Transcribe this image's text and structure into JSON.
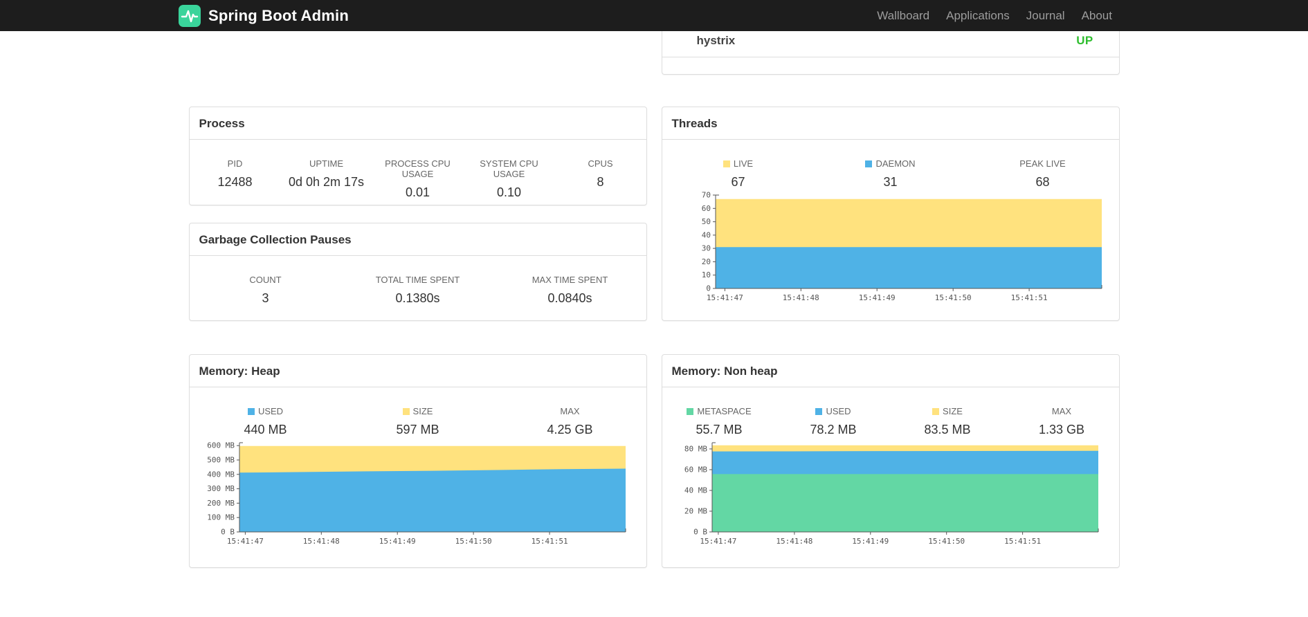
{
  "navbar": {
    "brand": "Spring Boot Admin",
    "items": [
      {
        "label": "Wallboard"
      },
      {
        "label": "Applications"
      },
      {
        "label": "Journal"
      },
      {
        "label": "About"
      }
    ]
  },
  "colors": {
    "brand_green": "#3AD49B",
    "status_up": "#2FBE2F",
    "chart_yellow": "#FFE27E",
    "chart_blue": "#4FB2E6",
    "chart_green": "#63D7A4"
  },
  "health": {
    "service": "hystrix",
    "status": "UP"
  },
  "process": {
    "title": "Process",
    "metrics": [
      {
        "label": "PID",
        "value": "12488"
      },
      {
        "label": "UPTIME",
        "value": "0d 0h 2m 17s"
      },
      {
        "label": "PROCESS CPU USAGE",
        "value": "0.01"
      },
      {
        "label": "SYSTEM CPU USAGE",
        "value": "0.10"
      },
      {
        "label": "CPUS",
        "value": "8"
      }
    ]
  },
  "gc": {
    "title": "Garbage Collection Pauses",
    "metrics": [
      {
        "label": "COUNT",
        "value": "3"
      },
      {
        "label": "TOTAL TIME SPENT",
        "value": "0.1380s"
      },
      {
        "label": "MAX TIME SPENT",
        "value": "0.0840s"
      }
    ]
  },
  "chart_data": [
    {
      "type": "area",
      "title": "Threads",
      "legend_position": "top",
      "grid": false,
      "ylim": [
        0,
        70
      ],
      "yticks": [
        {
          "value": 0,
          "label": "0"
        },
        {
          "value": 10,
          "label": "10"
        },
        {
          "value": 20,
          "label": "20"
        },
        {
          "value": 30,
          "label": "30"
        },
        {
          "value": 40,
          "label": "40"
        },
        {
          "value": 50,
          "label": "50"
        },
        {
          "value": 60,
          "label": "60"
        },
        {
          "value": 70,
          "label": "70"
        }
      ],
      "xticks": [
        {
          "pos": 0.024,
          "label": "15:41:47"
        },
        {
          "pos": 0.221,
          "label": "15:41:48"
        },
        {
          "pos": 0.418,
          "label": "15:41:49"
        },
        {
          "pos": 0.615,
          "label": "15:41:50"
        },
        {
          "pos": 0.812,
          "label": "15:41:51"
        }
      ],
      "legend": [
        {
          "label": "LIVE",
          "value": "67",
          "color": "#FFE27E"
        },
        {
          "label": "DAEMON",
          "value": "31",
          "color": "#4FB2E6"
        },
        {
          "label": "PEAK LIVE",
          "value": "68"
        }
      ],
      "layers": [
        {
          "name": "LIVE",
          "color": "#FFE27E",
          "values": [
            67,
            67,
            67,
            67,
            67,
            67,
            67
          ]
        },
        {
          "name": "DAEMON",
          "color": "#4FB2E6",
          "values": [
            31,
            31,
            31,
            31,
            31,
            31,
            31
          ]
        }
      ]
    },
    {
      "type": "area",
      "title": "Memory: Heap",
      "legend_position": "top",
      "grid": false,
      "ylim": [
        0,
        620
      ],
      "unit": "MB",
      "yticks": [
        {
          "value": 0,
          "label": "0 B"
        },
        {
          "value": 100,
          "label": "100 MB"
        },
        {
          "value": 200,
          "label": "200 MB"
        },
        {
          "value": 300,
          "label": "300 MB"
        },
        {
          "value": 400,
          "label": "400 MB"
        },
        {
          "value": 500,
          "label": "500 MB"
        },
        {
          "value": 600,
          "label": "600 MB"
        }
      ],
      "xticks": [
        {
          "pos": 0.015,
          "label": "15:41:47"
        },
        {
          "pos": 0.212,
          "label": "15:41:48"
        },
        {
          "pos": 0.409,
          "label": "15:41:49"
        },
        {
          "pos": 0.606,
          "label": "15:41:50"
        },
        {
          "pos": 0.803,
          "label": "15:41:51"
        }
      ],
      "legend": [
        {
          "label": "USED",
          "value": "440 MB",
          "color": "#4FB2E6"
        },
        {
          "label": "SIZE",
          "value": "597 MB",
          "color": "#FFE27E"
        },
        {
          "label": "MAX",
          "value": "4.25 GB"
        }
      ],
      "layers": [
        {
          "name": "SIZE",
          "color": "#FFE27E",
          "values": [
            597,
            597,
            597,
            597,
            597,
            597,
            597
          ]
        },
        {
          "name": "USED",
          "color": "#4FB2E6",
          "values": [
            412,
            416,
            421,
            425,
            430,
            436,
            440
          ]
        }
      ]
    },
    {
      "type": "area",
      "title": "Memory: Non heap",
      "legend_position": "top",
      "grid": false,
      "ylim": [
        0,
        86
      ],
      "unit": "MB",
      "yticks": [
        {
          "value": 0,
          "label": "0 B"
        },
        {
          "value": 20,
          "label": "20 MB"
        },
        {
          "value": 40,
          "label": "40 MB"
        },
        {
          "value": 60,
          "label": "60 MB"
        },
        {
          "value": 80,
          "label": "80 MB"
        }
      ],
      "xticks": [
        {
          "pos": 0.016,
          "label": "15:41:47"
        },
        {
          "pos": 0.213,
          "label": "15:41:48"
        },
        {
          "pos": 0.41,
          "label": "15:41:49"
        },
        {
          "pos": 0.607,
          "label": "15:41:50"
        },
        {
          "pos": 0.804,
          "label": "15:41:51"
        }
      ],
      "legend": [
        {
          "label": "METASPACE",
          "value": "55.7 MB",
          "color": "#63D7A4"
        },
        {
          "label": "USED",
          "value": "78.2 MB",
          "color": "#4FB2E6"
        },
        {
          "label": "SIZE",
          "value": "83.5 MB",
          "color": "#FFE27E"
        },
        {
          "label": "MAX",
          "value": "1.33 GB"
        }
      ],
      "layers": [
        {
          "name": "SIZE",
          "color": "#FFE27E",
          "values": [
            83.5,
            83.5,
            83.5,
            83.5,
            83.5,
            83.5,
            83.5
          ]
        },
        {
          "name": "USED",
          "color": "#4FB2E6",
          "values": [
            77.6,
            77.7,
            77.8,
            77.9,
            78,
            78.1,
            78.2
          ]
        },
        {
          "name": "METASPACE",
          "color": "#63D7A4",
          "values": [
            55.7,
            55.7,
            55.7,
            55.7,
            55.7,
            55.7,
            55.7
          ]
        }
      ]
    }
  ]
}
